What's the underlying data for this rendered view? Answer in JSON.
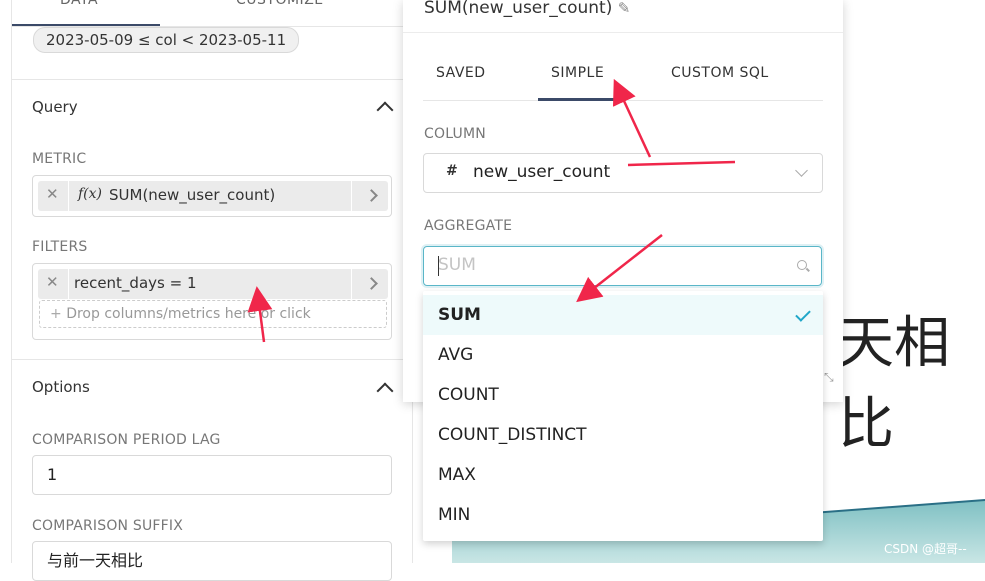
{
  "left_tabs": {
    "data": "DATA",
    "customize": "CUSTOMIZE"
  },
  "time_chip": "2023-05-09 ≤ col < 2023-05-11",
  "query": {
    "title": "Query",
    "metric_label": "METRIC",
    "metric_fn_icon": "f(x)",
    "metric_value": "SUM(new_user_count)",
    "filters_label": "FILTERS",
    "filter_value": "recent_days = 1",
    "drop_placeholder": "Drop columns/metrics here or click"
  },
  "options": {
    "title": "Options",
    "lag_label": "COMPARISON PERIOD LAG",
    "lag_value": "1",
    "suffix_label": "COMPARISON SUFFIX",
    "suffix_value": "与前一天相比"
  },
  "popover": {
    "title": "SUM(new_user_count)",
    "tabs": [
      "SAVED",
      "SIMPLE",
      "CUSTOM SQL"
    ],
    "active_tab": "SIMPLE",
    "column_label": "COLUMN",
    "column_type_icon": "#",
    "column_value": "new_user_count",
    "aggregate_label": "AGGREGATE",
    "aggregate_placeholder": "SUM"
  },
  "aggregate_options": [
    "SUM",
    "AVG",
    "COUNT",
    "COUNT_DISTINCT",
    "MAX",
    "MIN"
  ],
  "selected_aggregate": "SUM",
  "background_big_text": "天相比",
  "watermark": "CSDN @超哥--",
  "colors": {
    "accent": "#20a7c9",
    "tab_underline": "#3b4a68",
    "annotation_arrow": "#f0264a",
    "chart_teal": "#9ccfd2"
  }
}
